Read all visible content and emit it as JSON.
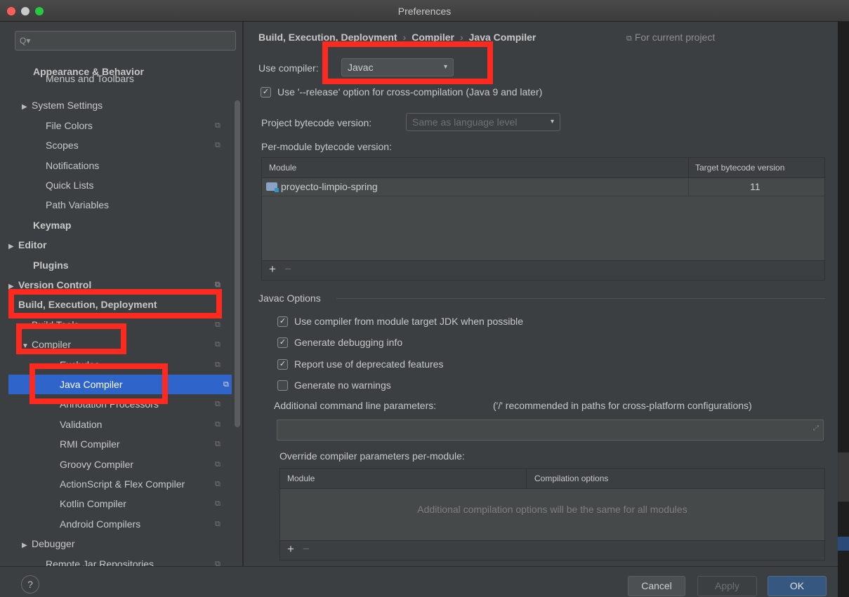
{
  "window": {
    "title": "Preferences"
  },
  "sidebar": {
    "search_placeholder": "Q▾",
    "items": [
      {
        "label": "Appearance & Behavior",
        "bold": true
      },
      {
        "label": "Menus and Toolbars"
      },
      {
        "label": "System Settings",
        "arrow": "▶"
      },
      {
        "label": "File Colors"
      },
      {
        "label": "Scopes"
      },
      {
        "label": "Notifications"
      },
      {
        "label": "Quick Lists"
      },
      {
        "label": "Path Variables"
      },
      {
        "label": "Keymap",
        "bold": true
      },
      {
        "label": "Editor",
        "bold": true,
        "arrow": "▶"
      },
      {
        "label": "Plugins",
        "bold": true
      },
      {
        "label": "Version Control",
        "bold": true,
        "arrow": "▶"
      },
      {
        "label": "Build, Execution, Deployment",
        "bold": true,
        "arrow": "▼"
      },
      {
        "label": "Build Tools",
        "arrow": "▶"
      },
      {
        "label": "Compiler",
        "arrow": "▼"
      },
      {
        "label": "Excludes"
      },
      {
        "label": "Java Compiler",
        "selected": true
      },
      {
        "label": "Annotation Processors"
      },
      {
        "label": "Validation"
      },
      {
        "label": "RMI Compiler"
      },
      {
        "label": "Groovy Compiler"
      },
      {
        "label": "ActionScript & Flex Compiler"
      },
      {
        "label": "Kotlin Compiler"
      },
      {
        "label": "Android Compilers"
      },
      {
        "label": "Debugger",
        "arrow": "▶"
      },
      {
        "label": "Remote Jar Repositories"
      }
    ]
  },
  "main": {
    "breadcrumb": [
      "Build, Execution, Deployment",
      "Compiler",
      "Java Compiler"
    ],
    "breadcrumb_sep": "›",
    "for_current_project": "For current project",
    "use_compiler_label": "Use compiler:",
    "compiler_value": "Javac",
    "release_option": "Use '--release' option for cross-compilation (Java 9 and later)",
    "project_bytecode_label": "Project bytecode version:",
    "project_bytecode_value": "Same as language level",
    "per_module_label": "Per-module bytecode version:",
    "module_table": {
      "headers": [
        "Module",
        "Target bytecode version"
      ],
      "rows": [
        {
          "module": "proyecto-limpio-spring",
          "target": "11"
        }
      ]
    },
    "javac_options_title": "Javac Options",
    "javac_options": [
      {
        "label": "Use compiler from module target JDK when possible",
        "checked": true
      },
      {
        "label": "Generate debugging info",
        "checked": true
      },
      {
        "label": "Report use of deprecated features",
        "checked": true
      },
      {
        "label": "Generate no warnings",
        "checked": false
      }
    ],
    "additional_params_label": "Additional command line parameters:",
    "additional_params_hint": "('/' recommended in paths for cross-platform configurations)",
    "override_label": "Override compiler parameters per-module:",
    "override_table": {
      "headers": [
        "Module",
        "Compilation options"
      ],
      "empty_text": "Additional compilation options will be the same for all modules"
    }
  },
  "footer": {
    "help": "?",
    "cancel": "Cancel",
    "apply": "Apply",
    "ok": "OK"
  },
  "colors": {
    "annotation": "#ff2a1f",
    "selection": "#2f65ca"
  },
  "icons": {
    "check": "✓",
    "dropdown": "▾",
    "plus": "+",
    "minus": "−",
    "page": "⧉",
    "expand": "⤢"
  }
}
